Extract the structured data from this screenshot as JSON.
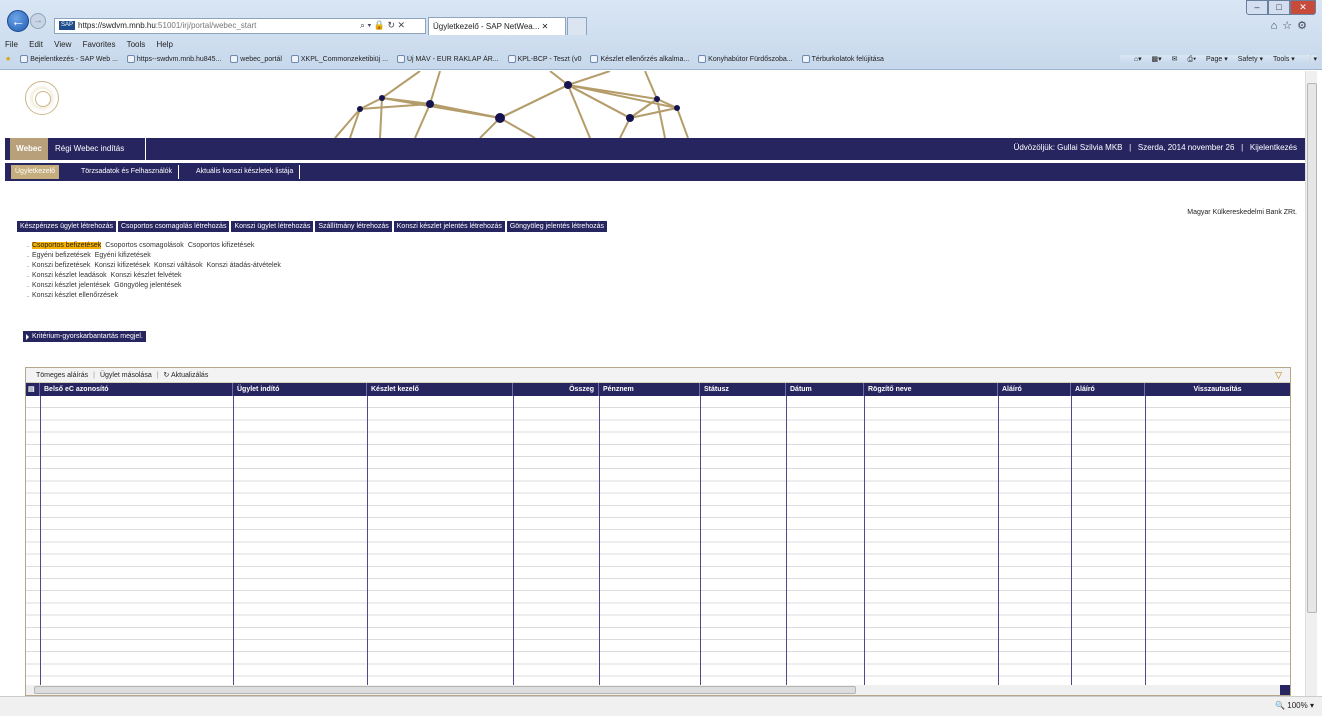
{
  "browser": {
    "url_host": "https://swdvm.mnb.hu",
    "url_rest": ":51001/irj/portal/webec_start",
    "address_tools": "⌕ ▾ ὑ2 ↻ ✕",
    "active_tab": "Ügyletkezelő - SAP NetWea...",
    "menu": [
      "File",
      "Edit",
      "View",
      "Favorites",
      "Tools",
      "Help"
    ],
    "favorites": [
      "Bejelentkezés - SAP Web ...",
      "https--swdvm.mnb.hu845...",
      "webec_portál",
      "XKPL_Commonzeketibiüj ...",
      "Új MÁV - EUR RAKLAP ÁR...",
      "KPL-BCP - Teszt (v0",
      "Készlet ellenőrzés alkalma...",
      "Konyhabútor Fürdőszoba...",
      "Térburkolatok felújitása"
    ],
    "commands": [
      "Page ▾",
      "Safety ▾",
      "Tools ▾"
    ],
    "zoom": "100%"
  },
  "header": {
    "webec_tab": "Webec",
    "regi": "Régi Webec indítás",
    "welcome": "Üdvözöljük: Gullai Szilvia MKB",
    "date": "Szerda, 2014 november 26",
    "logout": "Kijelentkezés"
  },
  "subnav": [
    "Ügyletkezelő",
    "Törzsadatok és Felhasználók",
    "Aktuális konszi készletek listája"
  ],
  "bank_name": "Magyar Külkereskedelmi Bank ZRt.",
  "action_buttons": [
    "Készpénzes ügylet létrehozás",
    "Csoportos csomagolás létrehozás",
    "Konszi ügylet létrehozás",
    "Szállítmány létrehozás",
    "Konszi készlet jelentés létrehozás",
    "Göngyöleg jelentés létrehozás"
  ],
  "links": [
    [
      "Csoportos befizetések",
      "Csoportos csomagolások",
      "Csoportos kifizetések"
    ],
    [
      "Egyéni befizetések",
      "Egyéni kifizetések"
    ],
    [
      "Konszi befizetések",
      "Konszi kifizetések",
      "Konszi váltások",
      "Konszi átadás-átvételek"
    ],
    [
      "Konszi készlet leadások",
      "Konszi készlet felvétek"
    ],
    [
      "Konszi készlet jelentések",
      "Göngyöleg jelentések"
    ],
    [
      "Konszi készlet ellenőrzések"
    ]
  ],
  "highlighted_link": "Csoportos befizetések",
  "kriterium": "Kritérium-gyorskarbantartás megjel.",
  "toolbar": {
    "mass_sign": "Tömeges aláírás",
    "copy": "Ügylet másolása",
    "refresh": "↻ Aktualizálás"
  },
  "table_columns": [
    "Belső eC azonosító",
    "Ügylet indító",
    "Készlet kezelő",
    "Összeg",
    "Pénznem",
    "Státusz",
    "Dátum",
    "Rögzítő neve",
    "Aláíró",
    "Aláíró",
    "Visszautasítás"
  ]
}
